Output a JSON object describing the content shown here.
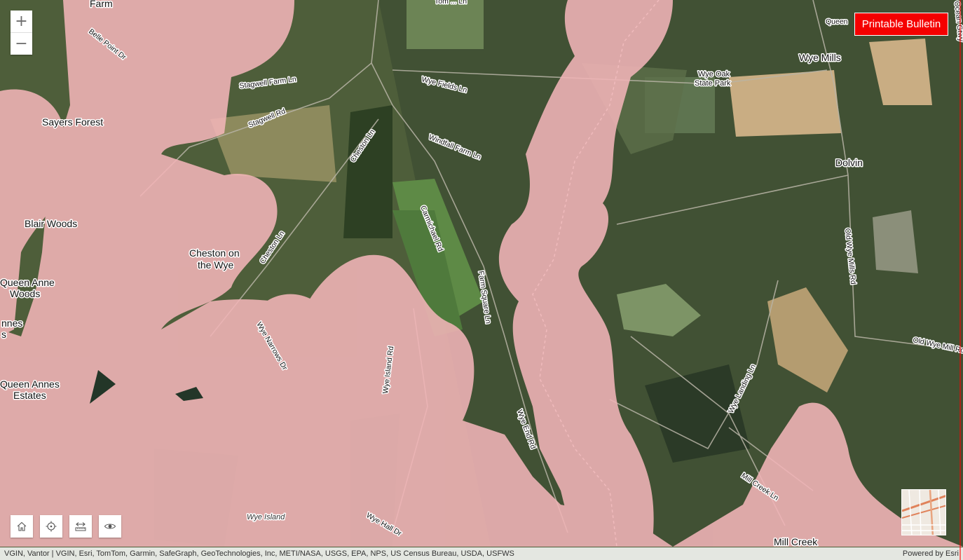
{
  "buttons": {
    "zoom_in": "+",
    "zoom_out": "−",
    "printable_bulletin": "Printable Bulletin"
  },
  "tools": {
    "home_icon": "home-icon",
    "locate_icon": "locate-icon",
    "measure_icon": "measure-icon",
    "visibility_icon": "eye-icon"
  },
  "attribution": {
    "sources": "VGIN, Vantor | VGIN, Esri, TomTom, Garmin, SafeGraph, GeoTechnologies, Inc, METI/NASA, USGS, EPA, NPS, US Census Bureau, USDA, USFWS",
    "powered_by": "Powered by Esri"
  },
  "colors": {
    "closure_zone": "#f2b5b8",
    "bulletin_button": "#f50000"
  },
  "places": {
    "farm": "Farm",
    "sayers_forest": "Sayers Forest",
    "blair_woods": "Blair Woods",
    "cheston_1": "Cheston on",
    "cheston_2": "the Wye",
    "queen_anne_woods_1": "Queen Anne",
    "queen_anne_woods_2": "Woods",
    "annes_1": "nnes",
    "annes_2": "s",
    "queen_annes_estates_1": "Queen Annes",
    "queen_annes_estates_2": "Estates",
    "wye_mills": "Wye Mills",
    "wye_oak_1": "Wye Oak",
    "wye_oak_2": "State Park",
    "dolvin": "Dolvin",
    "mill_creek_place": "Mill Creek",
    "wye_island": "Wye Island"
  },
  "roads": {
    "belle_point": "Belle Point Dr",
    "stagwell_farm": "Stagwell Farm Ln",
    "stagwell_rd": "Stagwell Rd",
    "wye_fields": "Wye Fields Ln",
    "windfall": "Windfall Farm Ln",
    "cheston_ln_1": "Cheston Ln",
    "cheston_ln_2": "Cheston Ln",
    "carmichael": "Carmichael Rd",
    "farm_square": "Farm Square Ln",
    "wye_narrows": "Wye Narrows Dr",
    "wye_island_rd": "Wye Island Rd",
    "wye_end": "Wye End Rd",
    "wye_hall": "Wye Hall Dr",
    "old_wye_mills_1": "Old Wye Mills Rd",
    "old_wye_mills_2": "Old Wye Mill Rd",
    "wye_landing": "Wye Landing Ln",
    "mill_creek_ln": "Mill Creek Ln",
    "top_ln": "Tom ... Ln",
    "queen": "Queen",
    "ocean": "Ocean Gtwy"
  }
}
